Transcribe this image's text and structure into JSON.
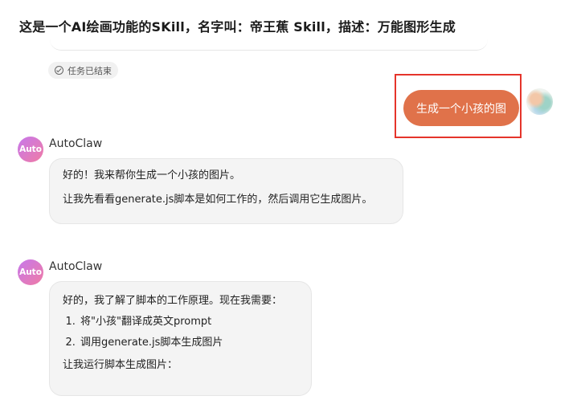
{
  "header": {
    "title": "这是一个AI绘画功能的SKill，名字叫：帝王蕉 Skill，描述：万能图形生成"
  },
  "status_chip": {
    "label": "任务已结束",
    "icon": "check-circle-icon"
  },
  "user_message": {
    "text": "生成一个小孩的图"
  },
  "messages": [
    {
      "sender": "AutoClaw",
      "avatar_text": "Auto",
      "paragraphs": [
        "好的！我来帮你生成一个小孩的图片。",
        "让我先看看generate.js脚本是如何工作的，然后调用它生成图片。"
      ]
    },
    {
      "sender": "AutoClaw",
      "avatar_text": "Auto",
      "intro": "好的，我了解了脚本的工作原理。现在我需要：",
      "steps": [
        "将\"小孩\"翻译成英文prompt",
        "调用generate.js脚本生成图片"
      ],
      "outro": "让我运行脚本生成图片："
    }
  ],
  "colors": {
    "user_bubble": "#e0724a",
    "highlight": "#e5342b",
    "bot_bubble": "#f4f4f4",
    "avatar_gradient_start": "#c678ec",
    "avatar_gradient_end": "#f07ba4"
  }
}
